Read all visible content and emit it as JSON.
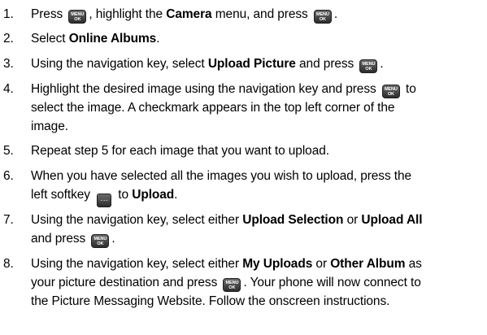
{
  "keys": {
    "menu_top": "MENU",
    "menu_bottom": "OK",
    "softkey_glyph": "…"
  },
  "steps": [
    {
      "num": "1.",
      "lines": [
        {
          "a": "Press ",
          "b": ", highlight the ",
          "bold1": "Camera",
          "c": " menu, and press ",
          "d": "."
        }
      ]
    },
    {
      "num": "2.",
      "lines": [
        {
          "a": "Select ",
          "bold1": "Online Albums",
          "b": "."
        }
      ]
    },
    {
      "num": "3.",
      "lines": [
        {
          "a": "Using the navigation key, select ",
          "bold1": "Upload Picture",
          "b": " and press ",
          "c": "."
        }
      ]
    },
    {
      "num": "4.",
      "lines": [
        {
          "a": "Highlight the desired image using the navigation key and press ",
          "b": " to"
        },
        {
          "text": "select the image. A checkmark appears in the top left corner of the"
        },
        {
          "text": "image."
        }
      ]
    },
    {
      "num": "5.",
      "lines": [
        {
          "text": "Repeat step 5 for each image that you want to upload."
        }
      ]
    },
    {
      "num": "6.",
      "lines": [
        {
          "text": "When you have selected all the images you wish to upload, press the"
        },
        {
          "a": "left softkey ",
          "b": " to ",
          "bold1": "Upload",
          "c": "."
        }
      ]
    },
    {
      "num": "7.",
      "lines": [
        {
          "a": "Using the navigation key, select either ",
          "bold1": "Upload Selection",
          "b": " or ",
          "bold2": "Upload All"
        },
        {
          "a": "and press ",
          "b": "."
        }
      ]
    },
    {
      "num": "8.",
      "lines": [
        {
          "a": "Using the navigation key, select either ",
          "bold1": "My Uploads",
          "b": " or ",
          "bold2": "Other Album",
          "c": " as"
        },
        {
          "a": "your picture destination and press ",
          "b": ". Your phone will now connect to"
        },
        {
          "text": "the Picture Messaging Website. Follow the onscreen instructions."
        }
      ]
    }
  ]
}
